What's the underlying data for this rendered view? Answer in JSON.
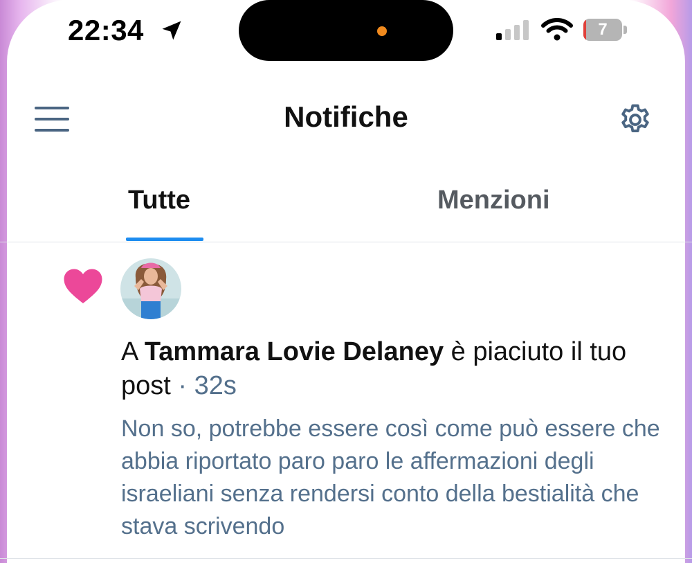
{
  "status_bar": {
    "time": "22:34",
    "battery_level": "7",
    "battery_fraction": 0.07,
    "icons": [
      "location-arrow-icon",
      "cellular-signal-icon",
      "wifi-icon",
      "battery-icon"
    ]
  },
  "header": {
    "title": "Notifiche",
    "left_icon": "hamburger-menu-icon",
    "right_icon": "gear-icon"
  },
  "tabs": [
    {
      "label": "Tutte",
      "active": true
    },
    {
      "label": "Menzioni",
      "active": false
    }
  ],
  "notification": {
    "type_icon": "heart-icon",
    "prefix": "A ",
    "user_name": "Tammara Lovie Delaney",
    "action": " è piaciuto il tuo post",
    "separator": " · ",
    "time_ago": "32s",
    "post_excerpt": "Non so, potrebbe essere così come può essere che abbia riportato paro paro le affermazioni degli israeliani senza rendersi conto della bestialità che stava scrivendo"
  },
  "colors": {
    "accent": "#1d8cf0",
    "heart": "#ec4899",
    "muted_text": "#54708c",
    "battery_low": "#e0403a"
  }
}
